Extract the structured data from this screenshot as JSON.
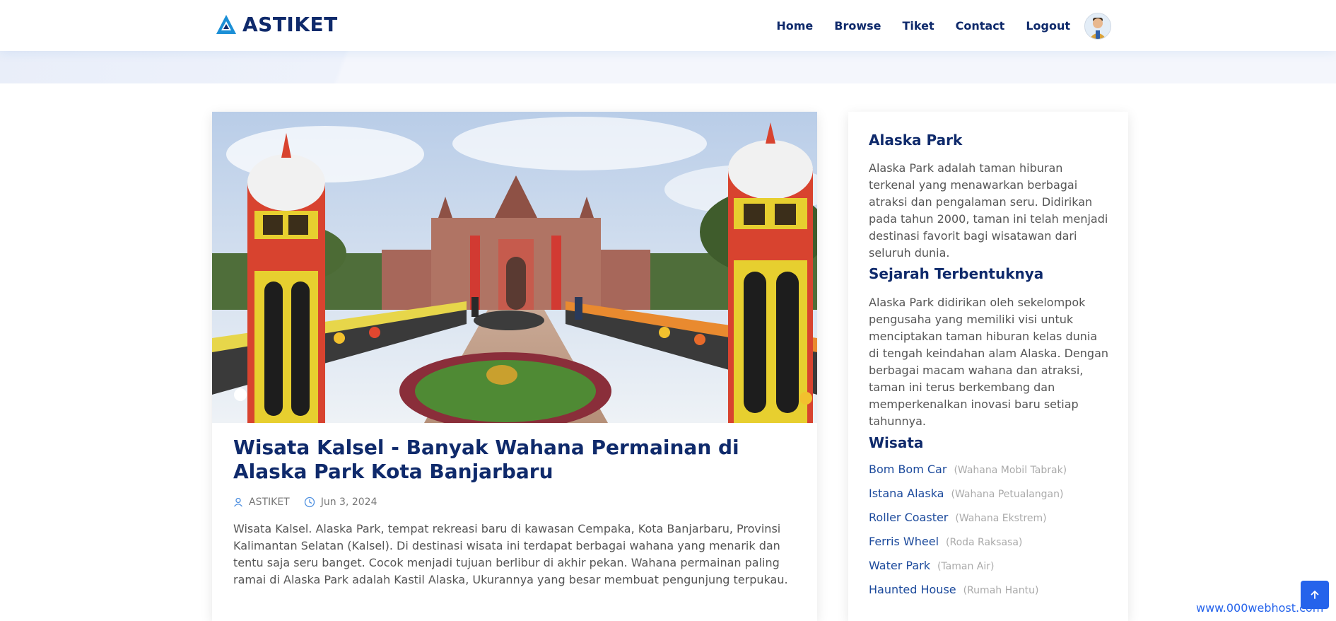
{
  "header": {
    "logo_text": "ASTIKET",
    "nav": [
      {
        "label": "Home"
      },
      {
        "label": "Browse"
      },
      {
        "label": "Tiket"
      },
      {
        "label": "Contact"
      },
      {
        "label": "Logout"
      }
    ],
    "avatar_icon": "user-avatar-icon"
  },
  "post": {
    "image_icon": "castle-park-photo",
    "title": "Wisata Kalsel - Banyak Wahana Permainan di Alaska Park Kota Banjarbaru",
    "author": "ASTIKET",
    "date": "Jun 3, 2024",
    "excerpt": "Wisata Kalsel. Alaska Park, tempat rekreasi baru di kawasan Cempaka, Kota Banjarbaru, Provinsi Kalimantan Selatan (Kalsel). Di destinasi wisata ini terdapat berbagai wahana yang menarik dan tentu saja seru banget. Cocok menjadi tujuan berlibur di akhir pekan. Wahana permainan paling ramai di Alaska Park adalah Kastil Alaska, Ukurannya yang besar membuat pengunjung terpukau."
  },
  "sidebar": {
    "about_title": "Alaska Park",
    "about_text": "Alaska Park adalah taman hiburan terkenal yang menawarkan berbagai atraksi dan pengalaman seru. Didirikan pada tahun 2000, taman ini telah menjadi destinasi favorit bagi wisatawan dari seluruh dunia.",
    "history_title": "Sejarah Terbentuknya",
    "history_text": "Alaska Park didirikan oleh sekelompok pengusaha yang memiliki visi untuk menciptakan taman hiburan kelas dunia di tengah keindahan alam Alaska. Dengan berbagai macam wahana dan atraksi, taman ini terus berkembang dan memperkenalkan inovasi baru setiap tahunnya.",
    "wisata_title": "Wisata",
    "wisata": [
      {
        "name": "Bom Bom Car",
        "type": "(Wahana Mobil Tabrak)"
      },
      {
        "name": "Istana Alaska",
        "type": "(Wahana Petualangan)"
      },
      {
        "name": "Roller Coaster",
        "type": "(Wahana Ekstrem)"
      },
      {
        "name": "Ferris Wheel",
        "type": "(Roda Raksasa)"
      },
      {
        "name": "Water Park",
        "type": "(Taman Air)"
      },
      {
        "name": "Haunted House",
        "type": "(Rumah Hantu)"
      }
    ]
  },
  "footer": {
    "host_text": "www.000webhost.com",
    "to_top_icon": "arrow-up-icon"
  },
  "colors": {
    "brand_navy": "#0f2a6b",
    "link_blue": "#1c4a9c",
    "accent_blue": "#2563eb",
    "logo_cyan": "#1b8fd6"
  }
}
